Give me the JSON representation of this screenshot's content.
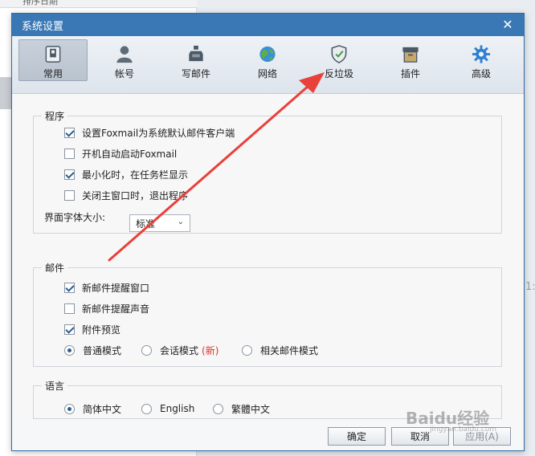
{
  "background": {
    "top_strip_text": "排序日期",
    "side_number": "1:"
  },
  "dialog": {
    "title": "系统设置",
    "close_glyph": "✕"
  },
  "toolbar": {
    "items": [
      {
        "label": "常用",
        "icon": "general-settings-icon",
        "active": true
      },
      {
        "label": "帐号",
        "icon": "account-user-icon",
        "active": false
      },
      {
        "label": "写邮件",
        "icon": "compose-ink-icon",
        "active": false
      },
      {
        "label": "网络",
        "icon": "network-globe-icon",
        "active": false
      },
      {
        "label": "反垃圾",
        "icon": "antispam-shield-icon",
        "active": false
      },
      {
        "label": "插件",
        "icon": "plugin-box-icon",
        "active": false
      },
      {
        "label": "高级",
        "icon": "advanced-gear-icon",
        "active": false
      }
    ]
  },
  "program_group": {
    "title": "程序",
    "options": [
      {
        "label": "设置Foxmail为系统默认邮件客户端",
        "checked": true
      },
      {
        "label": "开机自动启动Foxmail",
        "checked": false
      },
      {
        "label": "最小化时，在任务栏显示",
        "checked": true
      },
      {
        "label": "关闭主窗口时，退出程序",
        "checked": false
      }
    ],
    "font_size_label": "界面字体大小:",
    "font_size_value": "标准"
  },
  "mail_group": {
    "title": "邮件",
    "options": [
      {
        "label": "新邮件提醒窗口",
        "checked": true
      },
      {
        "label": "新邮件提醒声音",
        "checked": false
      },
      {
        "label": "附件预览",
        "checked": true
      }
    ],
    "modes": [
      {
        "label": "普通模式",
        "checked": true
      },
      {
        "label": "会话模式",
        "checked": false,
        "tag": "(新)"
      },
      {
        "label": "相关邮件模式",
        "checked": false
      }
    ]
  },
  "language_group": {
    "title": "语言",
    "options": [
      {
        "label": "简体中文",
        "checked": true
      },
      {
        "label": "English",
        "checked": false
      },
      {
        "label": "繁體中文",
        "checked": false
      }
    ]
  },
  "buttons": {
    "ok": "确定",
    "cancel": "取消",
    "apply": "应用(A)"
  },
  "watermark": {
    "text": "Baidu经验",
    "subtext": "jingyan.baidu.com"
  },
  "colors": {
    "titlebar": "#3a78b5",
    "annotation_arrow": "#e8403a",
    "new_tag": "#d7352c"
  }
}
